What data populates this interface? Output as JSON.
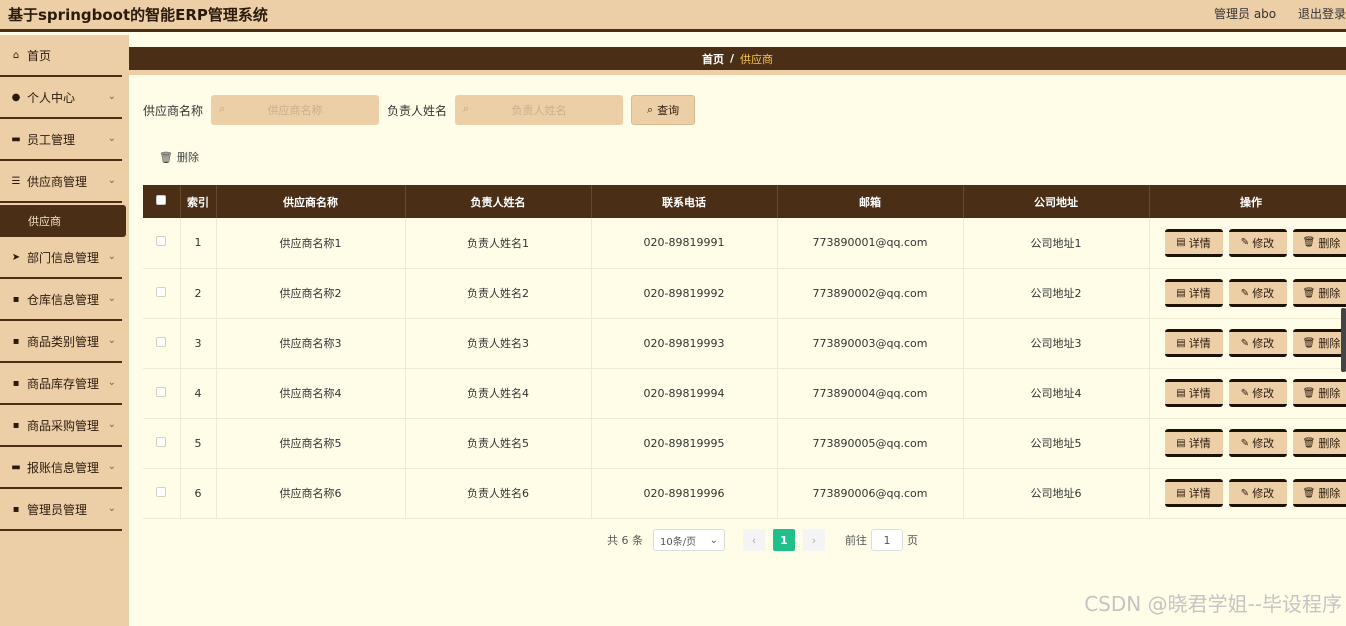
{
  "header": {
    "title": "基于springboot的智能ERP管理系统",
    "user_label": "管理员 abo",
    "logout_label": "退出登录"
  },
  "sidebar": {
    "items": [
      {
        "label": "首页",
        "icon": "home-icon",
        "glyph": "⌂",
        "has_chevron": false
      },
      {
        "label": "个人中心",
        "icon": "user-icon",
        "glyph": "●",
        "has_chevron": true
      },
      {
        "label": "员工管理",
        "icon": "chat-icon",
        "glyph": "▬",
        "has_chevron": true
      },
      {
        "label": "供应商管理",
        "icon": "list-icon",
        "glyph": "☰",
        "has_chevron": true,
        "submenu": "供应商"
      },
      {
        "label": "部门信息管理",
        "icon": "send-icon",
        "glyph": "➤",
        "has_chevron": true
      },
      {
        "label": "仓库信息管理",
        "icon": "grid-icon",
        "glyph": "▪",
        "has_chevron": true
      },
      {
        "label": "商品类别管理",
        "icon": "grid-icon",
        "glyph": "▪",
        "has_chevron": true
      },
      {
        "label": "商品库存管理",
        "icon": "grid-icon",
        "glyph": "▪",
        "has_chevron": true
      },
      {
        "label": "商品采购管理",
        "icon": "grid-icon",
        "glyph": "▪",
        "has_chevron": true
      },
      {
        "label": "报账信息管理",
        "icon": "monitor-icon",
        "glyph": "▬",
        "has_chevron": true
      },
      {
        "label": "管理员管理",
        "icon": "grid-icon",
        "glyph": "▪",
        "has_chevron": true
      }
    ]
  },
  "breadcrumb": {
    "home": "首页",
    "separator": "/",
    "current": "供应商"
  },
  "search": {
    "supplier_label": "供应商名称",
    "supplier_placeholder": "供应商名称",
    "contact_label": "负责人姓名",
    "contact_placeholder": "负责人姓名",
    "query_label": "查询"
  },
  "toolbar": {
    "delete_label": "删除"
  },
  "table": {
    "headers": [
      "",
      "索引",
      "供应商名称",
      "负责人姓名",
      "联系电话",
      "邮箱",
      "公司地址",
      "操作"
    ],
    "rows": [
      [
        "1",
        "供应商名称1",
        "负责人姓名1",
        "020-89819991",
        "773890001@qq.com",
        "公司地址1"
      ],
      [
        "2",
        "供应商名称2",
        "负责人姓名2",
        "020-89819992",
        "773890002@qq.com",
        "公司地址2"
      ],
      [
        "3",
        "供应商名称3",
        "负责人姓名3",
        "020-89819993",
        "773890003@qq.com",
        "公司地址3"
      ],
      [
        "4",
        "供应商名称4",
        "负责人姓名4",
        "020-89819994",
        "773890004@qq.com",
        "公司地址4"
      ],
      [
        "5",
        "供应商名称5",
        "负责人姓名5",
        "020-89819995",
        "773890005@qq.com",
        "公司地址5"
      ],
      [
        "6",
        "供应商名称6",
        "负责人姓名6",
        "020-89819996",
        "773890006@qq.com",
        "公司地址6"
      ]
    ],
    "actions": {
      "detail": "详情",
      "edit": "修改",
      "delete": "删除"
    }
  },
  "pagination": {
    "total": "共 6 条",
    "page_size": "10条/页",
    "current_page": "1",
    "goto_prefix": "前往",
    "goto_value": "1",
    "goto_suffix": "页"
  },
  "watermark": "CSDN @晓君学姐--毕设程序",
  "colors": {
    "primary_dark": "#4a2e16",
    "primary_light": "#eccea7",
    "background": "#fffde8",
    "active_page": "#21c08b"
  }
}
